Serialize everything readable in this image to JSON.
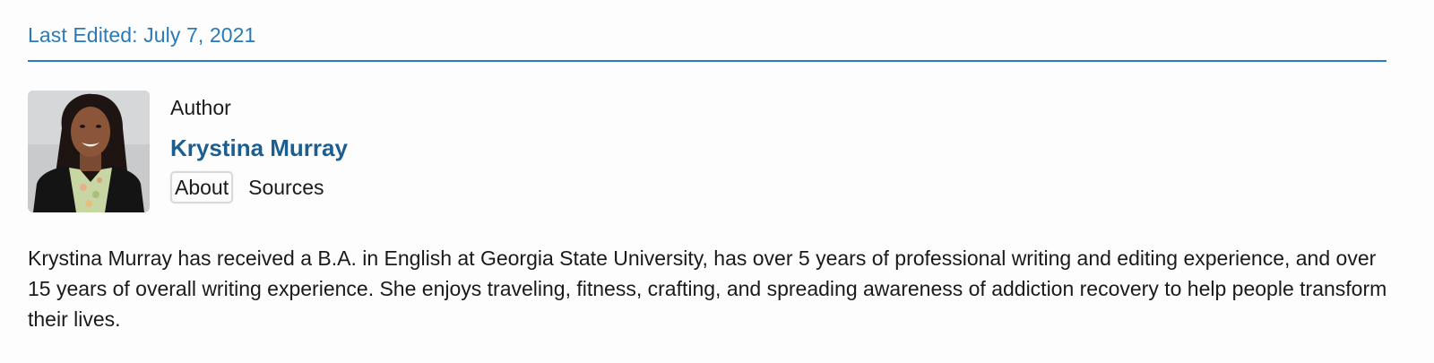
{
  "header": {
    "last_edited": "Last Edited: July 7, 2021"
  },
  "author": {
    "label": "Author",
    "name": "Krystina Murray",
    "avatar_icon": "author-portrait",
    "tabs": [
      {
        "label": "About",
        "active": true
      },
      {
        "label": "Sources",
        "active": false
      }
    ]
  },
  "bio": {
    "text": "Krystina Murray has received a B.A. in English at Georgia State University, has over 5 years of professional writing and editing experience, and over 15 years of overall writing experience. She enjoys traveling, fitness, crafting, and spreading awareness of addiction recovery to help people transform their lives."
  },
  "colors": {
    "accent": "#2a7ab8",
    "name": "#1b5e8f",
    "divider": "#2b7bc4",
    "text": "#1a1a1a"
  }
}
